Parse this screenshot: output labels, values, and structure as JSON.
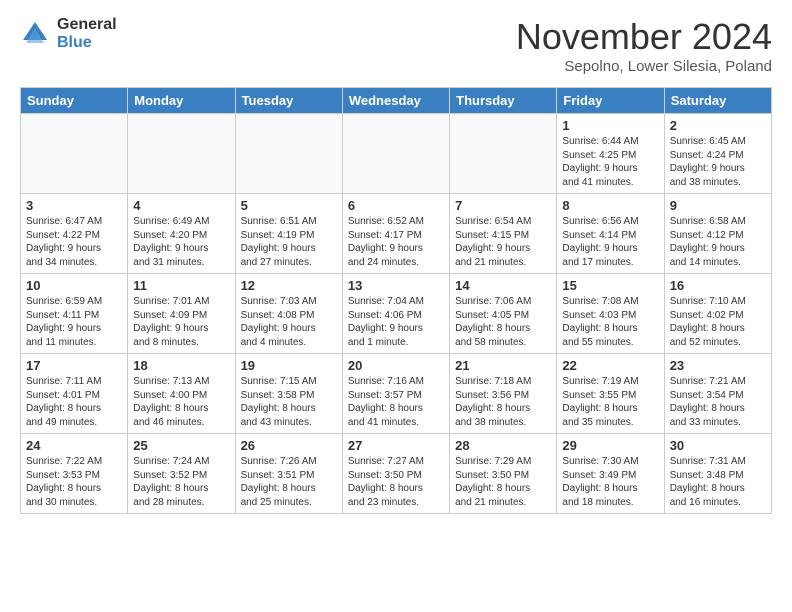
{
  "logo": {
    "general": "General",
    "blue": "Blue"
  },
  "header": {
    "month": "November 2024",
    "location": "Sepolno, Lower Silesia, Poland"
  },
  "weekdays": [
    "Sunday",
    "Monday",
    "Tuesday",
    "Wednesday",
    "Thursday",
    "Friday",
    "Saturday"
  ],
  "weeks": [
    [
      {
        "day": "",
        "info": ""
      },
      {
        "day": "",
        "info": ""
      },
      {
        "day": "",
        "info": ""
      },
      {
        "day": "",
        "info": ""
      },
      {
        "day": "",
        "info": ""
      },
      {
        "day": "1",
        "info": "Sunrise: 6:44 AM\nSunset: 4:25 PM\nDaylight: 9 hours\nand 41 minutes."
      },
      {
        "day": "2",
        "info": "Sunrise: 6:45 AM\nSunset: 4:24 PM\nDaylight: 9 hours\nand 38 minutes."
      }
    ],
    [
      {
        "day": "3",
        "info": "Sunrise: 6:47 AM\nSunset: 4:22 PM\nDaylight: 9 hours\nand 34 minutes."
      },
      {
        "day": "4",
        "info": "Sunrise: 6:49 AM\nSunset: 4:20 PM\nDaylight: 9 hours\nand 31 minutes."
      },
      {
        "day": "5",
        "info": "Sunrise: 6:51 AM\nSunset: 4:19 PM\nDaylight: 9 hours\nand 27 minutes."
      },
      {
        "day": "6",
        "info": "Sunrise: 6:52 AM\nSunset: 4:17 PM\nDaylight: 9 hours\nand 24 minutes."
      },
      {
        "day": "7",
        "info": "Sunrise: 6:54 AM\nSunset: 4:15 PM\nDaylight: 9 hours\nand 21 minutes."
      },
      {
        "day": "8",
        "info": "Sunrise: 6:56 AM\nSunset: 4:14 PM\nDaylight: 9 hours\nand 17 minutes."
      },
      {
        "day": "9",
        "info": "Sunrise: 6:58 AM\nSunset: 4:12 PM\nDaylight: 9 hours\nand 14 minutes."
      }
    ],
    [
      {
        "day": "10",
        "info": "Sunrise: 6:59 AM\nSunset: 4:11 PM\nDaylight: 9 hours\nand 11 minutes."
      },
      {
        "day": "11",
        "info": "Sunrise: 7:01 AM\nSunset: 4:09 PM\nDaylight: 9 hours\nand 8 minutes."
      },
      {
        "day": "12",
        "info": "Sunrise: 7:03 AM\nSunset: 4:08 PM\nDaylight: 9 hours\nand 4 minutes."
      },
      {
        "day": "13",
        "info": "Sunrise: 7:04 AM\nSunset: 4:06 PM\nDaylight: 9 hours\nand 1 minute."
      },
      {
        "day": "14",
        "info": "Sunrise: 7:06 AM\nSunset: 4:05 PM\nDaylight: 8 hours\nand 58 minutes."
      },
      {
        "day": "15",
        "info": "Sunrise: 7:08 AM\nSunset: 4:03 PM\nDaylight: 8 hours\nand 55 minutes."
      },
      {
        "day": "16",
        "info": "Sunrise: 7:10 AM\nSunset: 4:02 PM\nDaylight: 8 hours\nand 52 minutes."
      }
    ],
    [
      {
        "day": "17",
        "info": "Sunrise: 7:11 AM\nSunset: 4:01 PM\nDaylight: 8 hours\nand 49 minutes."
      },
      {
        "day": "18",
        "info": "Sunrise: 7:13 AM\nSunset: 4:00 PM\nDaylight: 8 hours\nand 46 minutes."
      },
      {
        "day": "19",
        "info": "Sunrise: 7:15 AM\nSunset: 3:58 PM\nDaylight: 8 hours\nand 43 minutes."
      },
      {
        "day": "20",
        "info": "Sunrise: 7:16 AM\nSunset: 3:57 PM\nDaylight: 8 hours\nand 41 minutes."
      },
      {
        "day": "21",
        "info": "Sunrise: 7:18 AM\nSunset: 3:56 PM\nDaylight: 8 hours\nand 38 minutes."
      },
      {
        "day": "22",
        "info": "Sunrise: 7:19 AM\nSunset: 3:55 PM\nDaylight: 8 hours\nand 35 minutes."
      },
      {
        "day": "23",
        "info": "Sunrise: 7:21 AM\nSunset: 3:54 PM\nDaylight: 8 hours\nand 33 minutes."
      }
    ],
    [
      {
        "day": "24",
        "info": "Sunrise: 7:22 AM\nSunset: 3:53 PM\nDaylight: 8 hours\nand 30 minutes."
      },
      {
        "day": "25",
        "info": "Sunrise: 7:24 AM\nSunset: 3:52 PM\nDaylight: 8 hours\nand 28 minutes."
      },
      {
        "day": "26",
        "info": "Sunrise: 7:26 AM\nSunset: 3:51 PM\nDaylight: 8 hours\nand 25 minutes."
      },
      {
        "day": "27",
        "info": "Sunrise: 7:27 AM\nSunset: 3:50 PM\nDaylight: 8 hours\nand 23 minutes."
      },
      {
        "day": "28",
        "info": "Sunrise: 7:29 AM\nSunset: 3:50 PM\nDaylight: 8 hours\nand 21 minutes."
      },
      {
        "day": "29",
        "info": "Sunrise: 7:30 AM\nSunset: 3:49 PM\nDaylight: 8 hours\nand 18 minutes."
      },
      {
        "day": "30",
        "info": "Sunrise: 7:31 AM\nSunset: 3:48 PM\nDaylight: 8 hours\nand 16 minutes."
      }
    ]
  ]
}
